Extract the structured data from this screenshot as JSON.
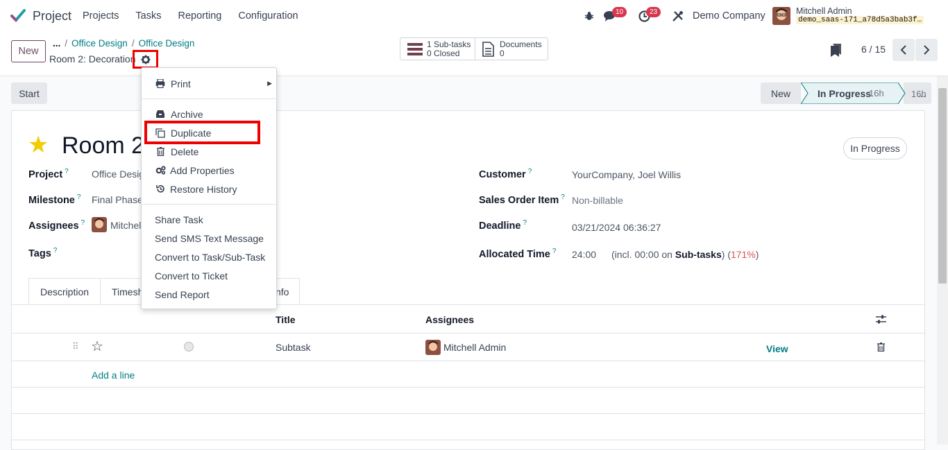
{
  "app": {
    "name": "Project"
  },
  "menu": [
    "Projects",
    "Tasks",
    "Reporting",
    "Configuration"
  ],
  "systray": {
    "messages_count": "10",
    "activities_count": "23",
    "company": "Demo Company",
    "user_name": "Mitchell Admin",
    "database": "demo_saas-171_a78d5a3bab3f…"
  },
  "control": {
    "new_label": "New",
    "breadcrumb": [
      "...",
      "Office Design",
      "Office Design"
    ],
    "record_name": "Room 2: Decoration",
    "subtasks_line1": "1 Sub-tasks",
    "subtasks_line2": "0 Closed",
    "documents_label": "Documents",
    "documents_count": "0",
    "pager": "6 / 15"
  },
  "statusbar": {
    "start_label": "Start",
    "stages": [
      "New",
      "In Progress",
      "..."
    ],
    "in_progress_time": "16h"
  },
  "form": {
    "title": "Room 2",
    "status": "In Progress",
    "left_fields": [
      {
        "label": "Project",
        "value": "Office Desig"
      },
      {
        "label": "Milestone",
        "value": "Final Phase"
      },
      {
        "label": "Assignees",
        "value": "Mitchel"
      },
      {
        "label": "Tags",
        "value": ""
      }
    ],
    "right_fields": [
      {
        "label": "Customer",
        "value": "YourCompany, Joel Willis"
      },
      {
        "label": "Sales Order Item",
        "value": "Non-billable"
      },
      {
        "label": "Deadline",
        "value": "03/21/2024 06:36:27"
      },
      {
        "label": "Allocated Time",
        "value": "24:00"
      }
    ],
    "allocated_extra_pre": "(incl. 00:00 on ",
    "allocated_extra_bold": "Sub-tasks",
    "allocated_extra_mid": ") (",
    "allocated_extra_pct": "171%",
    "allocated_extra_post": ")",
    "help_mark": "?",
    "tabs": [
      "Description",
      "Timesh",
      "nfo"
    ]
  },
  "subtasks": {
    "headers": {
      "title": "Title",
      "assignees": "Assignees"
    },
    "rows": [
      {
        "title": "Subtask",
        "assignee": "Mitchell Admin",
        "view_label": "View"
      }
    ],
    "add_line": "Add a line"
  },
  "dropdown": {
    "items": [
      {
        "label": "Print",
        "icon": "printer-icon"
      },
      {
        "label": "Archive",
        "icon": "archive-icon"
      },
      {
        "label": "Duplicate",
        "icon": "copy-icon"
      },
      {
        "label": "Delete",
        "icon": "trash-icon"
      },
      {
        "label": "Add Properties",
        "icon": "cogs-icon"
      },
      {
        "label": "Restore History",
        "icon": "history-icon"
      },
      {
        "label": "Share Task"
      },
      {
        "label": "Send SMS Text Message"
      },
      {
        "label": "Convert to Task/Sub-Task"
      },
      {
        "label": "Convert to Ticket"
      },
      {
        "label": "Send Report"
      }
    ]
  },
  "colors": {
    "brand": "#714b67",
    "link": "#017e84",
    "highlight": "#e00000"
  }
}
